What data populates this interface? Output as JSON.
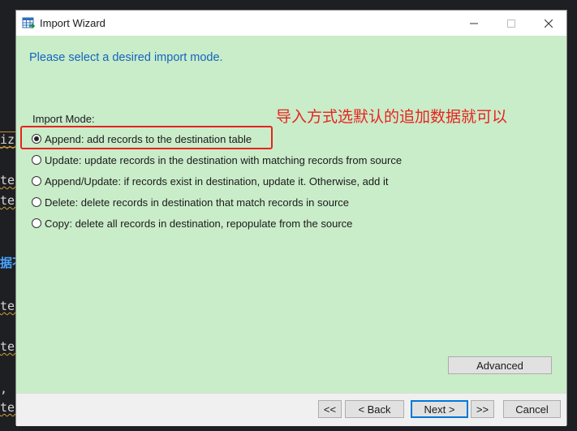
{
  "background_fragments": [
    {
      "text": "ize"
    },
    {
      "text": "ter"
    },
    {
      "text": "ter"
    },
    {
      "text": "据不"
    },
    {
      "text": "ter"
    },
    {
      "text": "ter"
    },
    {
      "text": ","
    },
    {
      "text": "ter"
    }
  ],
  "window": {
    "title": "Import Wizard",
    "app_icon": "table-import-icon",
    "controls": {
      "minimize": "minimize-icon",
      "maximize": "maximize-icon",
      "close": "close-icon"
    }
  },
  "page": {
    "heading": "Please select a desired import mode.",
    "mode_label": "Import Mode:",
    "annotation": "导入方式选默认的追加数据就可以",
    "highlight_color": "#e8231e"
  },
  "import_modes": [
    {
      "label": "Append: add records to the destination table",
      "selected": true
    },
    {
      "label": "Update: update records in the destination with matching records from source",
      "selected": false
    },
    {
      "label": "Append/Update: if records exist in destination, update it. Otherwise, add it",
      "selected": false
    },
    {
      "label": "Delete: delete records in destination that match records in source",
      "selected": false
    },
    {
      "label": "Copy: delete all records in destination, repopulate from the source",
      "selected": false
    }
  ],
  "buttons": {
    "advanced": "Advanced",
    "first": "<<",
    "back": "< Back",
    "next": "Next >",
    "last": ">>",
    "cancel": "Cancel"
  },
  "colors": {
    "dialog_bg": "#c9ecc9",
    "heading": "#1565c0",
    "annotation": "#e8231e"
  }
}
